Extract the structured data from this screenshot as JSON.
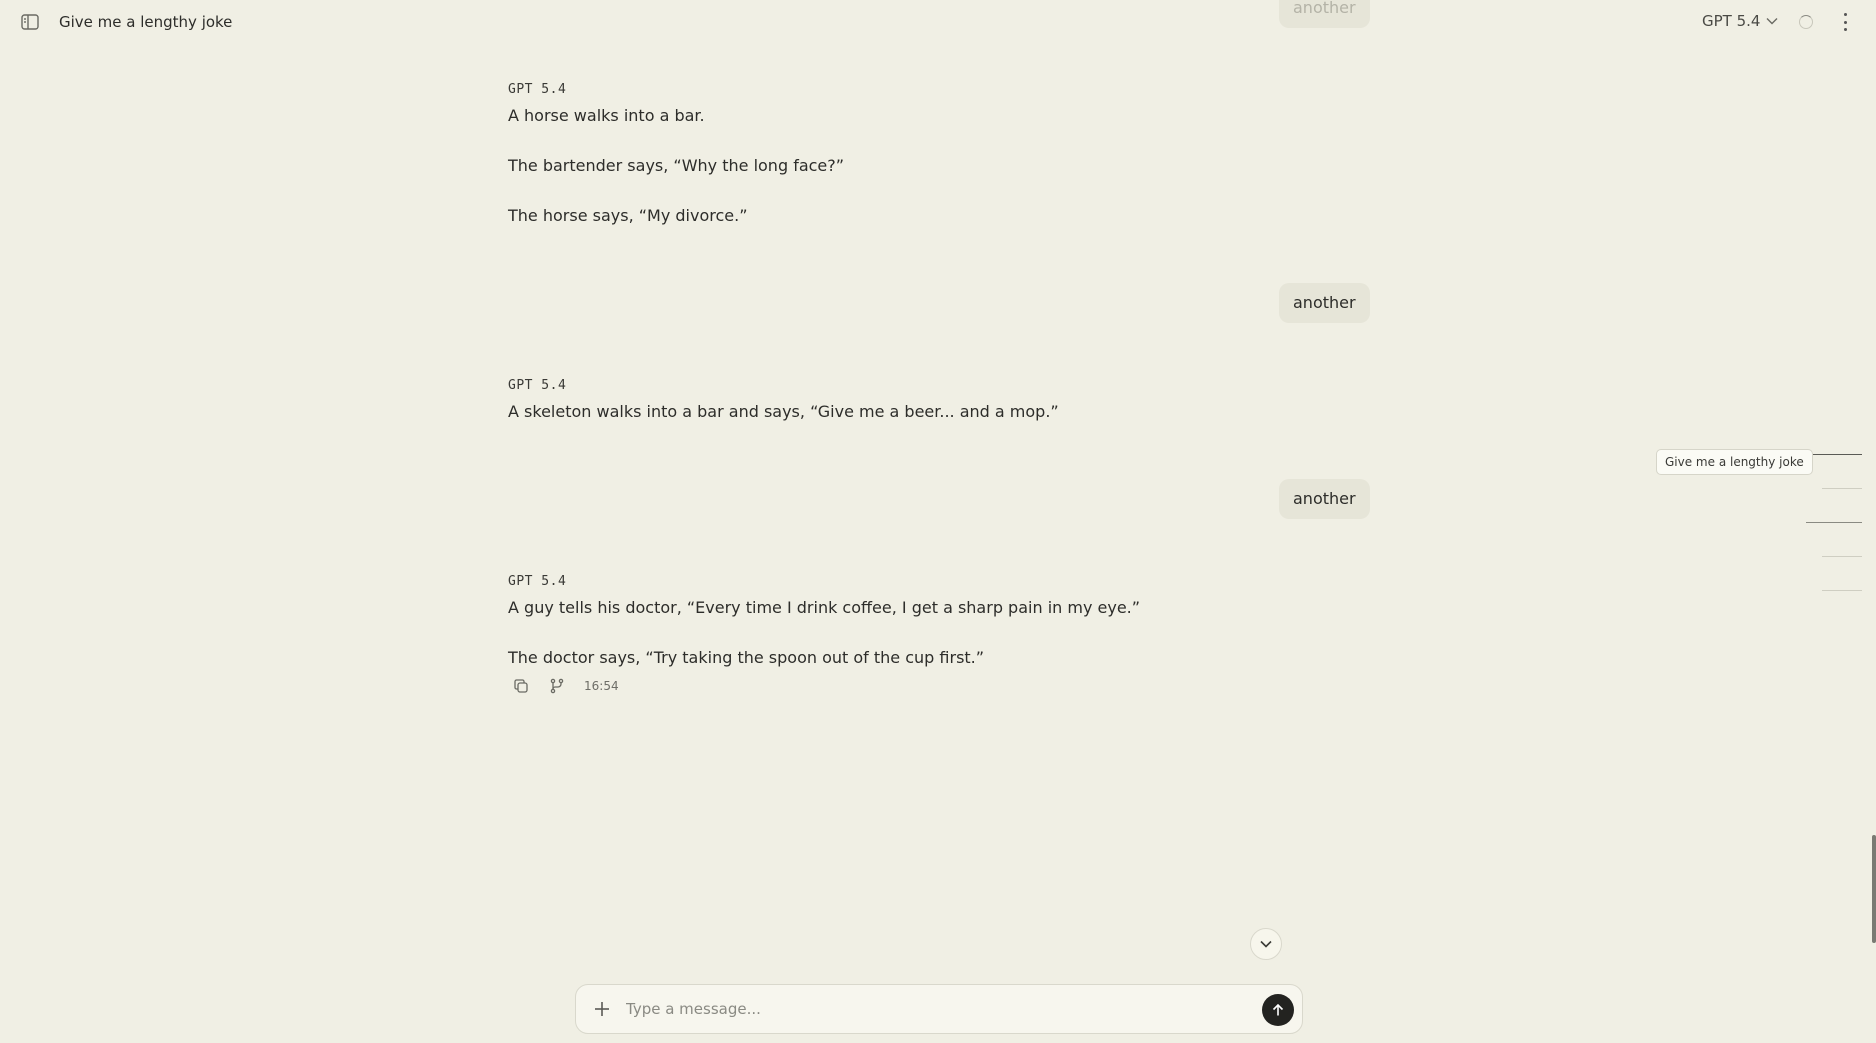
{
  "header": {
    "chat_title": "Give me a lengthy joke",
    "model_name": "GPT 5.4"
  },
  "messages": [
    {
      "role": "user",
      "text": "another"
    },
    {
      "role": "assistant",
      "model": "GPT 5.4",
      "lines": [
        "A horse walks into a bar.",
        "The bartender says, “Why the long face?”",
        "The horse says, “My divorce.”"
      ]
    },
    {
      "role": "user",
      "text": "another"
    },
    {
      "role": "assistant",
      "model": "GPT 5.4",
      "lines": [
        "A skeleton walks into a bar and says, “Give me a beer... and a mop.”"
      ]
    },
    {
      "role": "user",
      "text": "another"
    },
    {
      "role": "assistant",
      "model": "GPT 5.4",
      "lines": [
        "A guy tells his doctor, “Every time I drink coffee, I get a sharp pain in my eye.”",
        "The doctor says, “Try taking the spoon out of the cup first.”"
      ],
      "timestamp": "16:54"
    }
  ],
  "minimap": {
    "tooltip": "Give me a lengthy joke"
  },
  "composer": {
    "placeholder": "Type a message..."
  },
  "icons": {
    "sidebar": "sidebar-toggle-icon",
    "model_dropdown": "chevron-down-icon",
    "status": "spinner-icon",
    "menu": "more-vertical-icon",
    "copy": "copy-icon",
    "branch": "branch-icon",
    "scroll_down": "chevron-down-icon",
    "attach": "plus-icon",
    "send": "arrow-up-icon"
  }
}
